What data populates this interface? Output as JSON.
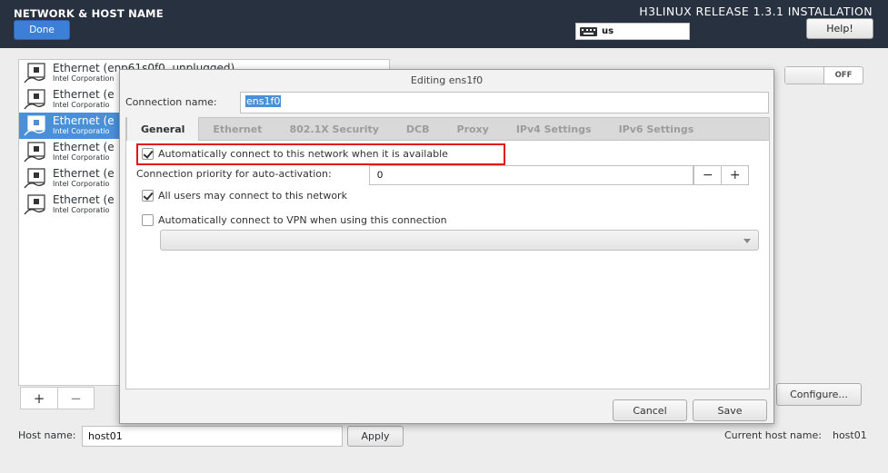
{
  "header": {
    "title": "NETWORK & HOST NAME",
    "done_label": "Done",
    "release": "H3LINUX RELEASE 1.3.1 INSTALLATION",
    "keyboard_layout": "us",
    "help_label": "Help!"
  },
  "network_list": {
    "items": [
      {
        "name": "Ethernet (enp61s0f0, unplugged)",
        "vendor": "Intel Corporation",
        "selected": false
      },
      {
        "name": "Ethernet (e",
        "vendor": "Intel Corporatio",
        "selected": false
      },
      {
        "name": "Ethernet (e",
        "vendor": "Intel Corporatio",
        "selected": true
      },
      {
        "name": "Ethernet (e",
        "vendor": "Intel Corporatio",
        "selected": false
      },
      {
        "name": "Ethernet (e",
        "vendor": "Intel Corporatio",
        "selected": false
      },
      {
        "name": "Ethernet (e",
        "vendor": "Intel Corporatio",
        "selected": false
      }
    ],
    "add_label": "+",
    "remove_label": "−"
  },
  "device_panel": {
    "toggle_label": "OFF",
    "configure_label": "Configure..."
  },
  "hostname": {
    "label": "Host name:",
    "value": "host01",
    "apply_label": "Apply",
    "current_label": "Current host name:",
    "current_value": "host01"
  },
  "dialog": {
    "title": "Editing ens1f0",
    "connection_name_label": "Connection name:",
    "connection_name_value": "ens1f0",
    "tabs": [
      "General",
      "Ethernet",
      "802.1X Security",
      "DCB",
      "Proxy",
      "IPv4 Settings",
      "IPv6 Settings"
    ],
    "active_tab": "General",
    "general": {
      "auto_connect_label": "Automatically connect to this network when it is available",
      "auto_connect_checked": true,
      "priority_label": "Connection priority for auto-activation:",
      "priority_value": "0",
      "priority_minus": "−",
      "priority_plus": "+",
      "all_users_label": "All users may connect to this network",
      "all_users_checked": true,
      "vpn_label": "Automatically connect to VPN when using this connection",
      "vpn_checked": false,
      "vpn_selected": ""
    },
    "cancel_label": "Cancel",
    "save_label": "Save"
  },
  "colors": {
    "header_bg": "#283140",
    "accent": "#4a90d9",
    "highlight_border": "#e0161c"
  }
}
